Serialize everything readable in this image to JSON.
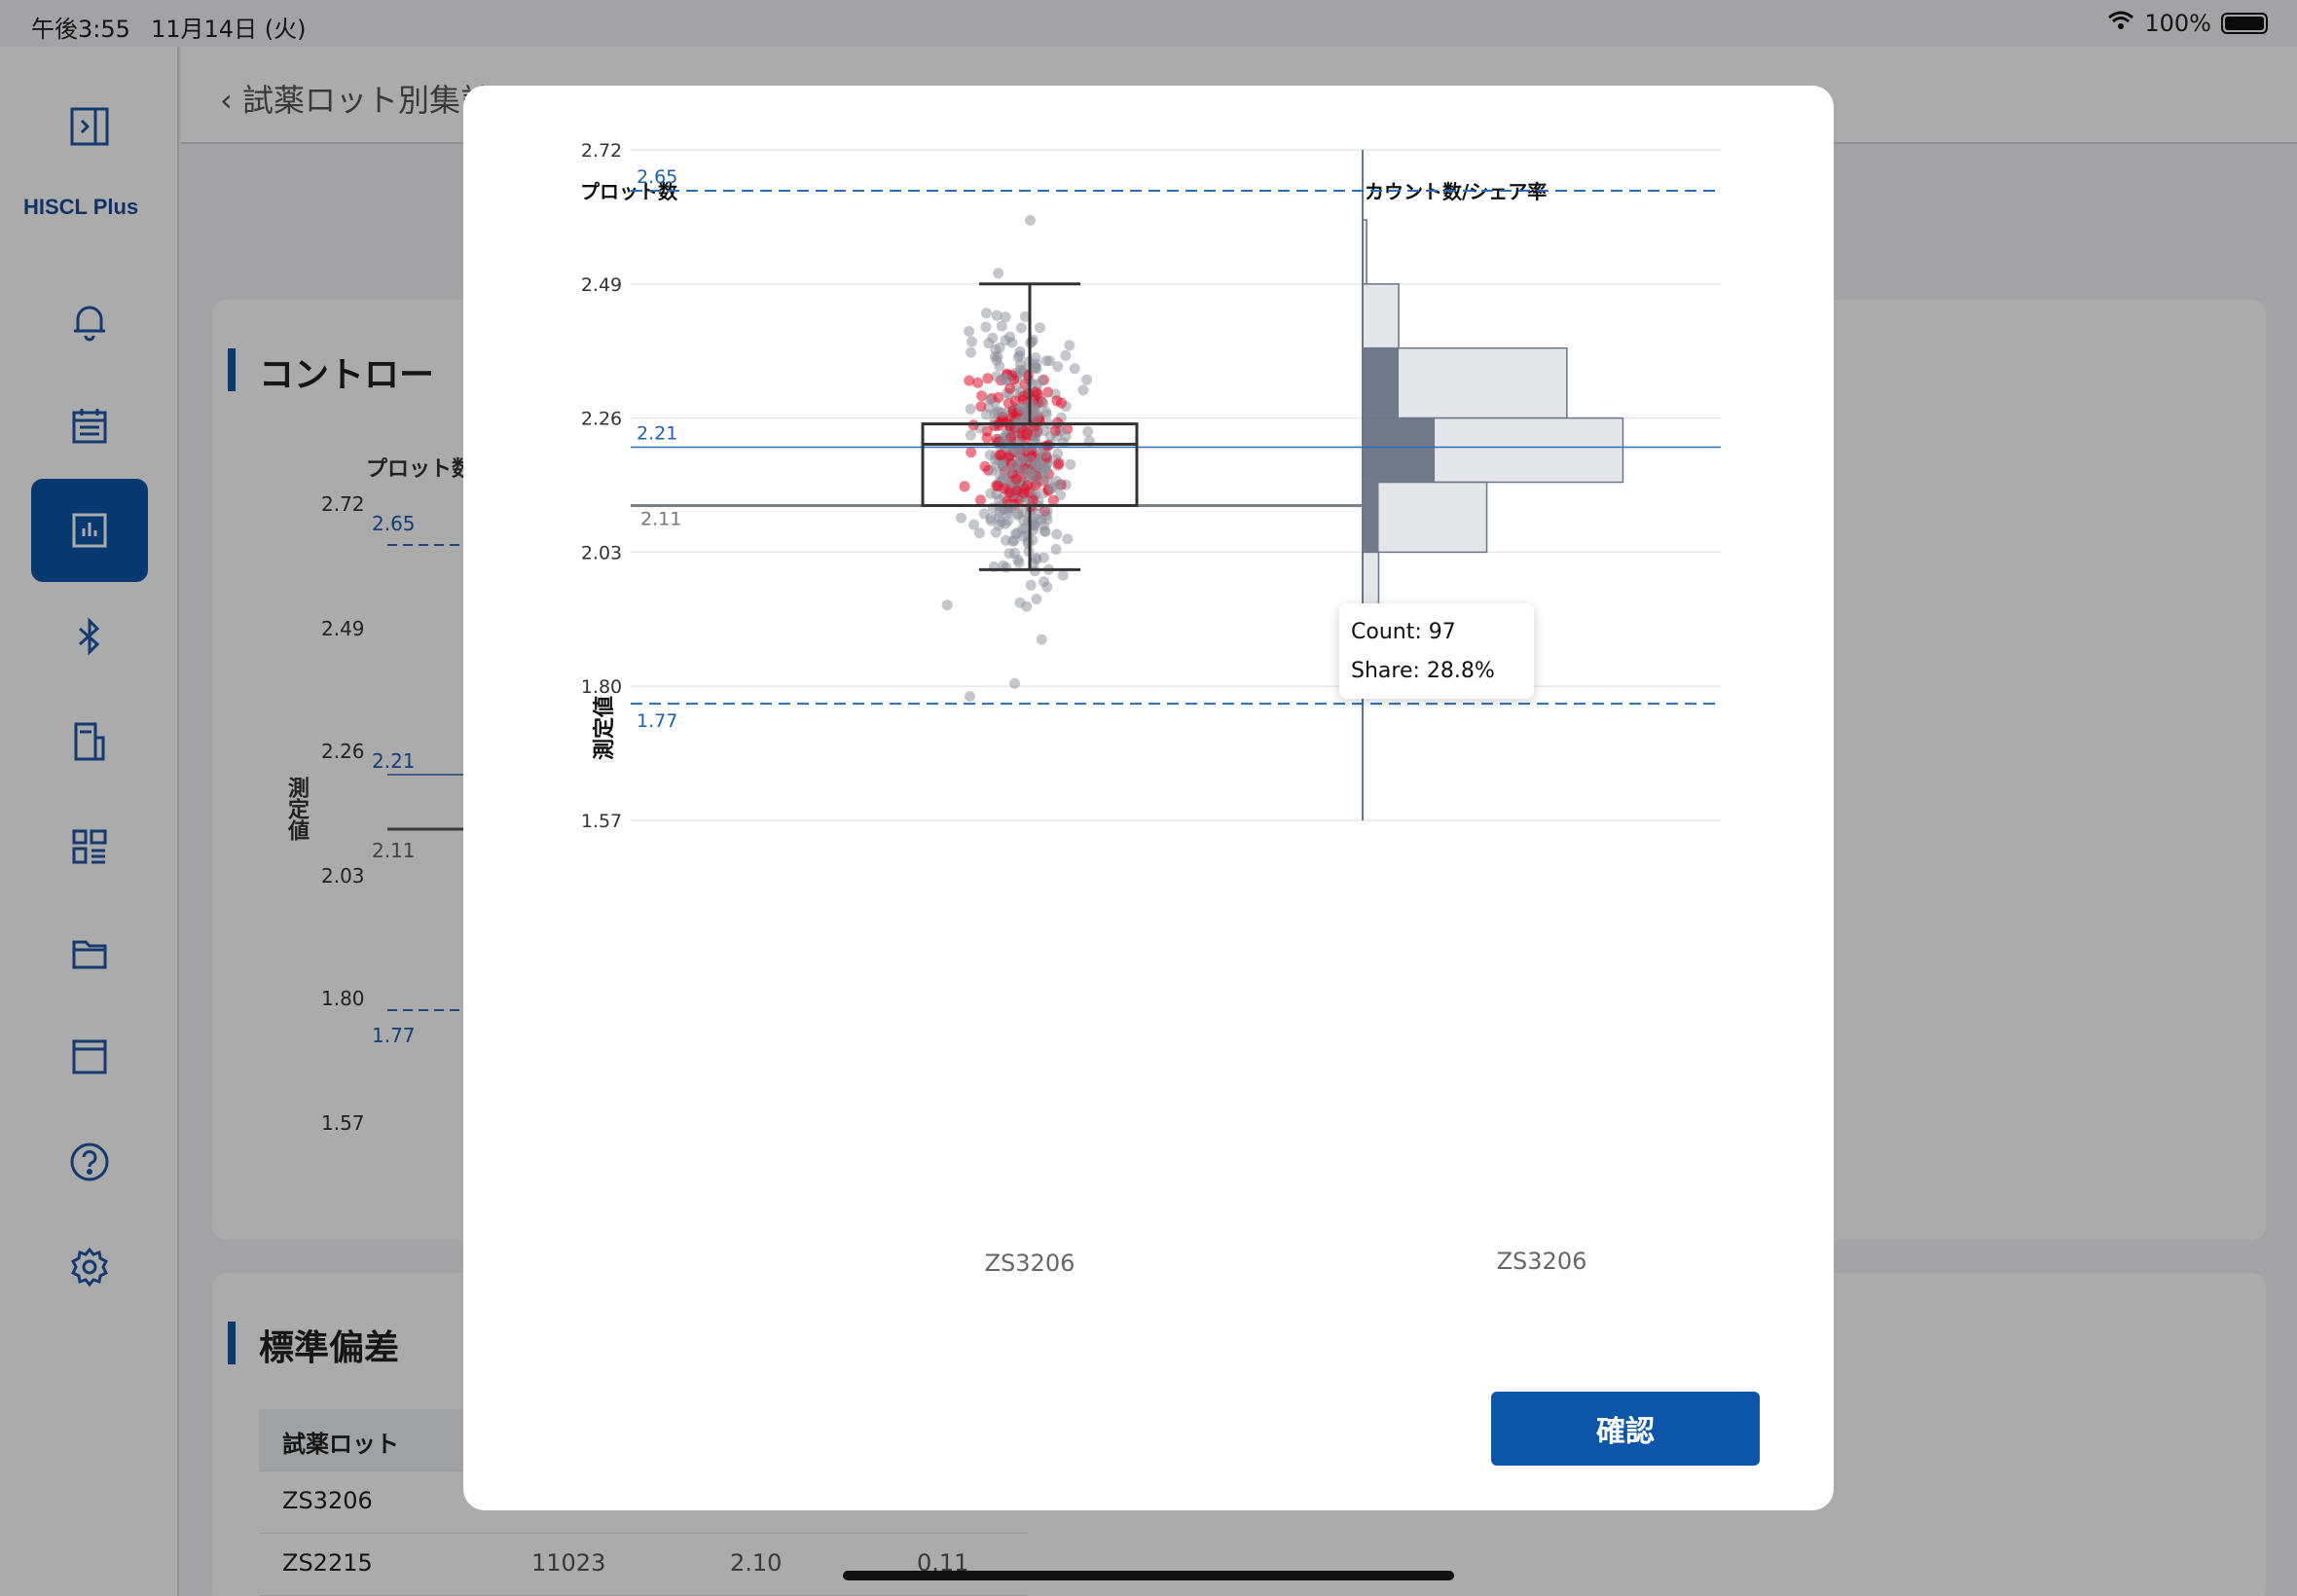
{
  "status": {
    "time": "午後3:55",
    "date": "11月14日 (火)",
    "battery": "100%"
  },
  "sidebar": {
    "logo": "HISCL Plus",
    "items": [
      {
        "icon": "sidebar-toggle-icon"
      },
      {
        "icon": "bell-icon"
      },
      {
        "icon": "calendar-icon"
      },
      {
        "icon": "chart-icon",
        "active": true
      },
      {
        "icon": "bluetooth-icon"
      },
      {
        "icon": "document-icon"
      },
      {
        "icon": "dashboard-icon"
      },
      {
        "icon": "folder-icon"
      },
      {
        "icon": "window-icon"
      },
      {
        "icon": "help-icon"
      },
      {
        "icon": "gear-icon"
      }
    ]
  },
  "background": {
    "back_label": "試薬ロット別集計",
    "card1_title": "コントロー",
    "card1_plot_label": "プロット数",
    "card1_axis_label": "測定値",
    "card1_ticks": [
      "2.72",
      "2.49",
      "2.26",
      "2.03",
      "1.80",
      "1.57"
    ],
    "card1_refs": [
      "2.65",
      "2.21",
      "2.11",
      "1.77"
    ],
    "card2_title": "標準偏差",
    "table_header": "試薬ロット",
    "table_rows": [
      {
        "lot": "ZS3206",
        "n": "",
        "mean": "",
        "sd": ""
      },
      {
        "lot": "ZS2215",
        "n": "11023",
        "mean": "2.10",
        "sd": "0.11"
      }
    ]
  },
  "modal": {
    "confirm_label": "確認",
    "tooltip": {
      "count": "Count: 97",
      "share": "Share: 28.8%"
    }
  },
  "chart_data": {
    "type": "box+histogram",
    "left_title": "プロット数",
    "right_title": "カウント数/シェア率",
    "ylabel": "測定値",
    "ylim": [
      1.57,
      2.72
    ],
    "yticks": [
      2.72,
      2.49,
      2.26,
      2.03,
      1.8,
      1.57
    ],
    "category": "ZS3206",
    "reference_lines": [
      {
        "value": 2.65,
        "label": "2.65",
        "style": "dashed"
      },
      {
        "value": 2.21,
        "label": "2.21",
        "style": "solid-blue"
      },
      {
        "value": 2.11,
        "label": "2.11",
        "style": "solid-gray"
      },
      {
        "value": 1.77,
        "label": "1.77",
        "style": "dashed"
      }
    ],
    "box": {
      "q1": 2.11,
      "median": 2.215,
      "q3": 2.25,
      "whisker_low": 2.0,
      "whisker_high": 2.49
    },
    "histogram": {
      "bins": [
        {
          "low": 2.49,
          "high": 2.6,
          "count": 1,
          "highlight": 0
        },
        {
          "low": 2.38,
          "high": 2.49,
          "count": 9,
          "highlight": 0
        },
        {
          "low": 2.26,
          "high": 2.38,
          "count": 51,
          "highlight": 9
        },
        {
          "low": 2.15,
          "high": 2.26,
          "count": 65,
          "highlight": 18
        },
        {
          "low": 2.03,
          "high": 2.15,
          "count": 31,
          "highlight": 4
        },
        {
          "low": 1.92,
          "high": 2.03,
          "count": 4,
          "highlight": 0
        },
        {
          "low": 1.8,
          "high": 1.92,
          "count": 2,
          "highlight": 0
        }
      ],
      "xmax": 70
    }
  }
}
